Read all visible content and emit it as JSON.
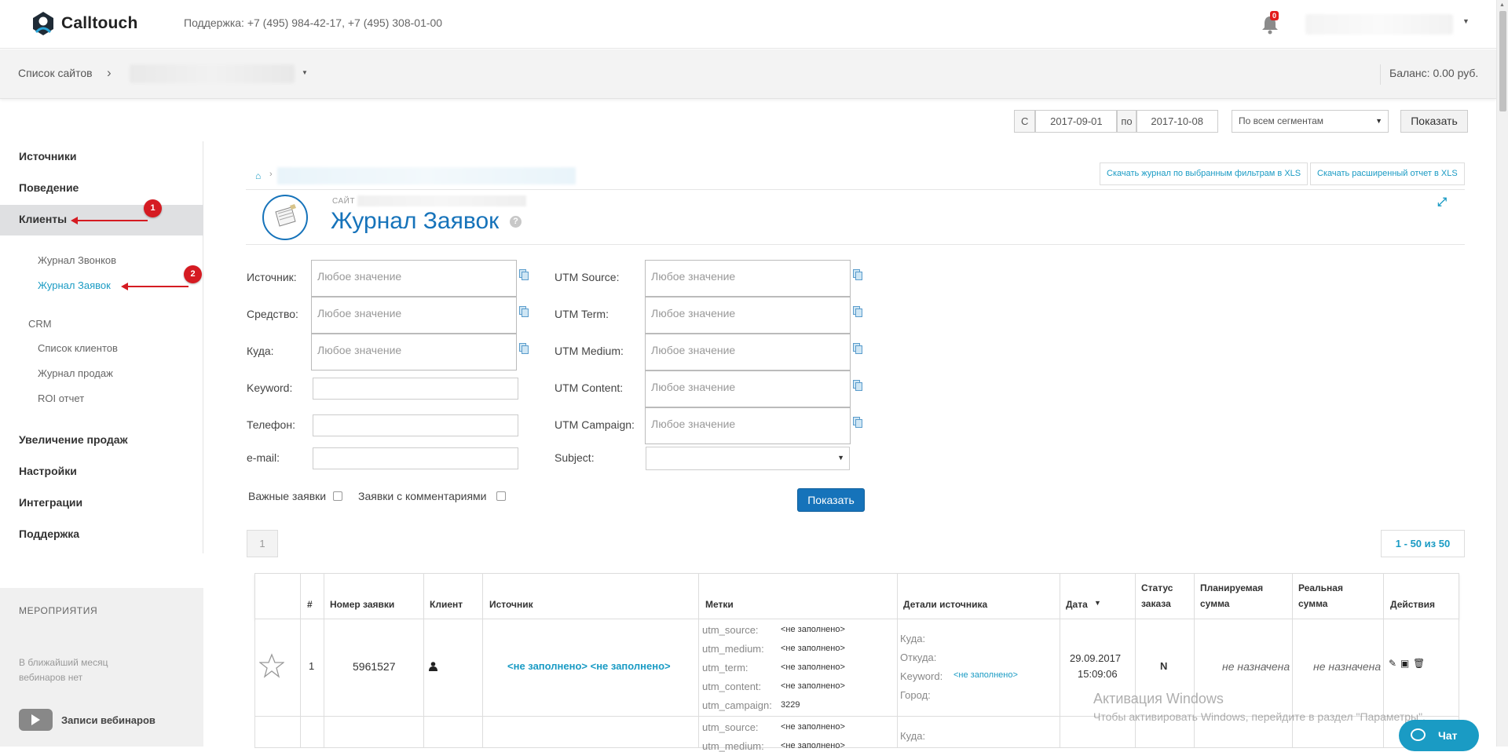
{
  "header": {
    "brand": "Calltouch",
    "support": "Поддержка: +7 (495) 984-42-17, +7 (495) 308-01-00",
    "notifications_count": "0",
    "brand_color": "#1673ba",
    "accent_color": "#1a9bc4"
  },
  "subbar": {
    "sites_label": "Список сайтов",
    "balance": "Баланс: 0.00 руб."
  },
  "datefilter": {
    "from_label": "С",
    "from": "2017-09-01",
    "to_label": "по",
    "to": "2017-10-08",
    "segment": "По всем сегментам",
    "show": "Показать"
  },
  "sidebar": {
    "items": [
      {
        "label": "Источники"
      },
      {
        "label": "Поведение"
      },
      {
        "label": "Клиенты"
      },
      {
        "label": "Увеличение продаж"
      },
      {
        "label": "Настройки"
      },
      {
        "label": "Интеграции"
      },
      {
        "label": "Поддержка"
      }
    ],
    "sub_items": [
      {
        "label": "Журнал Звонков"
      },
      {
        "label": "Журнал Заявок"
      }
    ],
    "crm_label": "CRM",
    "crm_items": [
      {
        "label": "Список клиентов"
      },
      {
        "label": "Журнал продаж"
      },
      {
        "label": "ROI отчет"
      }
    ],
    "events_title": "МЕРОПРИЯТИЯ",
    "events_text": "В ближайший месяц вебинаров нет",
    "webinars_label": "Записи вебинаров"
  },
  "annotations": {
    "marker1": "1",
    "marker2": "2"
  },
  "page": {
    "download_filtered": "Скачать журнал по выбранным фильтрам в XLS",
    "download_extended": "Скачать расширенный отчет в XLS",
    "site_label": "САЙТ",
    "title": "Журнал Заявок",
    "help": "?"
  },
  "filters": {
    "placeholder": "Любое значение",
    "source": "Источник:",
    "medium": "Средство:",
    "where": "Куда:",
    "keyword": "Keyword:",
    "phone": "Телефон:",
    "email": "e-mail:",
    "utm_source": "UTM Source:",
    "utm_term": "UTM Term:",
    "utm_medium": "UTM Medium:",
    "utm_content": "UTM Content:",
    "utm_campaign": "UTM Campaign:",
    "subject": "Subject:",
    "important": "Важные заявки",
    "with_comments": "Заявки с комментариями",
    "show": "Показать"
  },
  "pagination": {
    "page": "1",
    "range": "1 - 50 из 50"
  },
  "table": {
    "headers": {
      "num": "#",
      "order_no": "Номер заявки",
      "client": "Клиент",
      "source": "Источник",
      "tags": "Метки",
      "source_details": "Детали источника",
      "date": "Дата",
      "order_status_1": "Статус",
      "order_status_2": "заказа",
      "planned_1": "Планируемая",
      "planned_2": "сумма",
      "real_1": "Реальная",
      "real_2": "сумма",
      "actions": "Действия"
    },
    "rows": [
      {
        "num": "1",
        "order_no": "5961527",
        "source": "<не заполнено> <не заполнено>",
        "utm": [
          {
            "k": "utm_source:",
            "v": "<не заполнено>"
          },
          {
            "k": "utm_medium:",
            "v": "<не заполнено>"
          },
          {
            "k": "utm_term:",
            "v": "<не заполнено>"
          },
          {
            "k": "utm_content:",
            "v": "<не заполнено>"
          },
          {
            "k": "utm_campaign:",
            "v": "3229"
          }
        ],
        "details": {
          "where": "Куда:",
          "from": "Откуда:",
          "keyword": "Keyword:",
          "keyword_value": "<не заполнено>",
          "city": "Город:"
        },
        "date": "29.09.2017",
        "time": "15:09:06",
        "status": "N",
        "planned": "не назначена",
        "real": "не назначена"
      },
      {
        "utm": [
          {
            "k": "utm_source:",
            "v": "<не заполнено>"
          },
          {
            "k": "utm_medium:",
            "v": "<не заполнено>"
          }
        ],
        "details": {
          "where": "Куда:"
        }
      }
    ]
  },
  "overlay": {
    "win_title": "Активация Windows",
    "win_sub": "Чтобы активировать Windows, перейдите в раздел \"Параметры\".",
    "chat": "Чат"
  }
}
